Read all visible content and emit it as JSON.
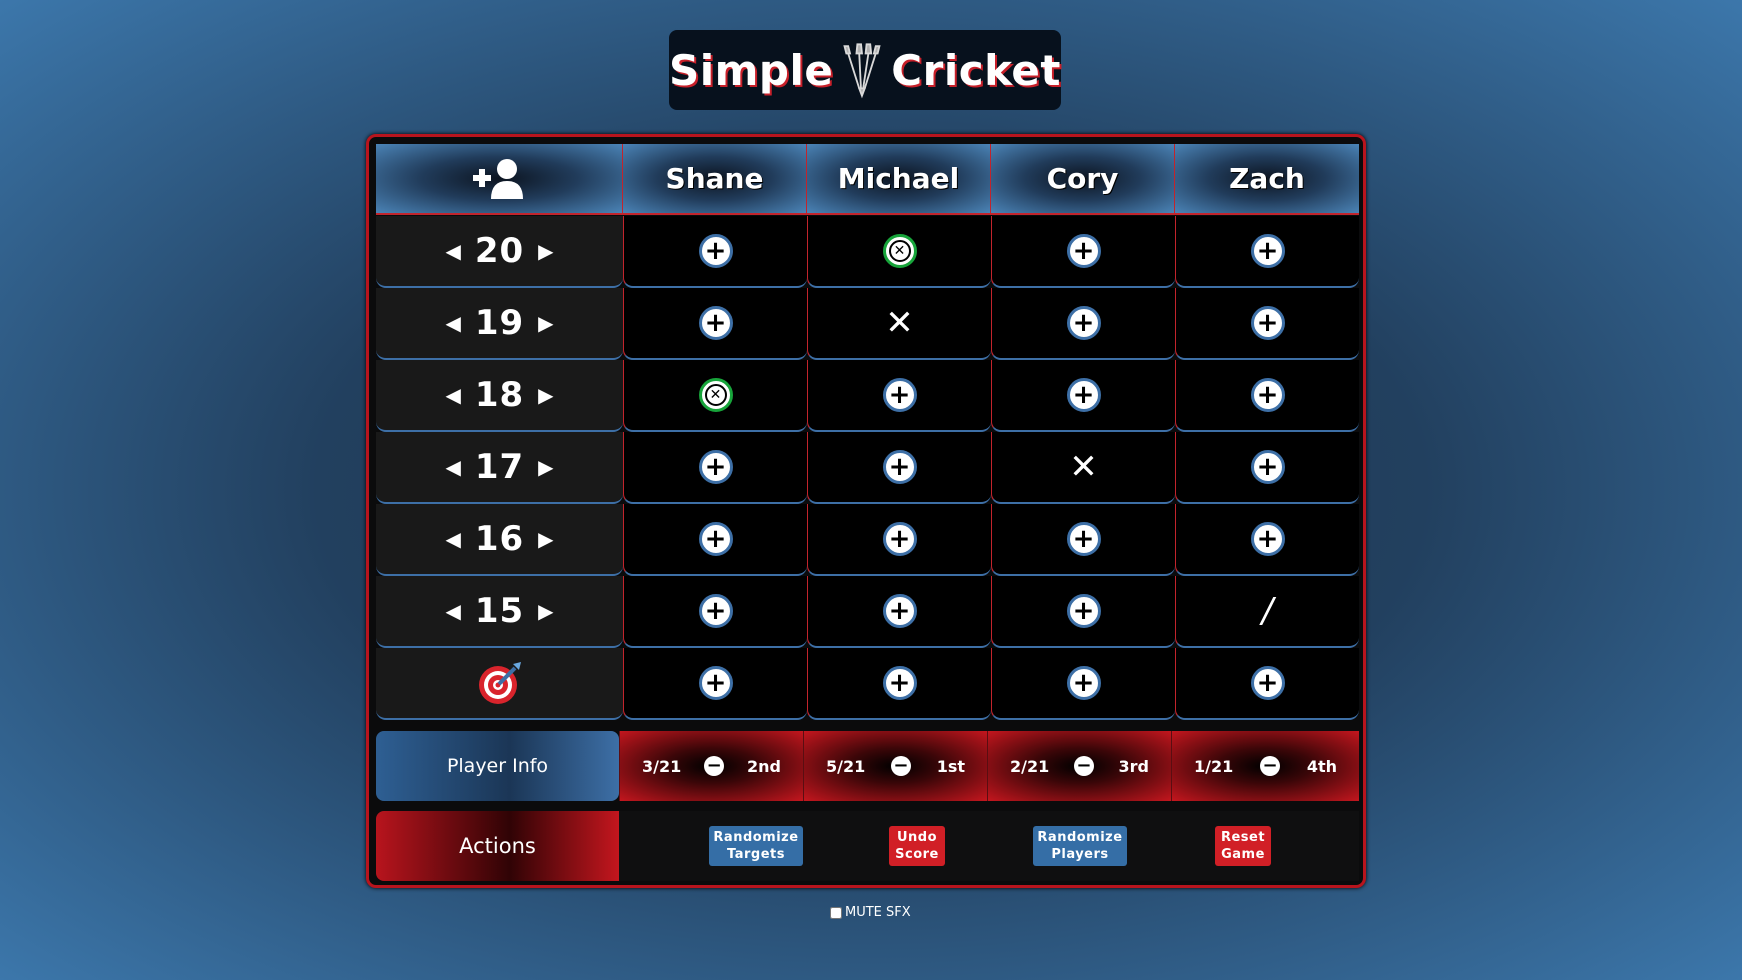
{
  "app": {
    "title_left": "Simple",
    "title_right": "Cricket",
    "logo_icon": "darts-icon"
  },
  "header": {
    "add_player_icon": "add-player-icon",
    "players": [
      "Shane",
      "Michael",
      "Cory",
      "Zach"
    ]
  },
  "targets": [
    {
      "label": "20",
      "prev_icon": "caret-left",
      "next_icon": "caret-right"
    },
    {
      "label": "19",
      "prev_icon": "caret-left",
      "next_icon": "caret-right"
    },
    {
      "label": "18",
      "prev_icon": "caret-left",
      "next_icon": "caret-right"
    },
    {
      "label": "17",
      "prev_icon": "caret-left",
      "next_icon": "caret-right"
    },
    {
      "label": "16",
      "prev_icon": "caret-left",
      "next_icon": "caret-right"
    },
    {
      "label": "15",
      "prev_icon": "caret-left",
      "next_icon": "caret-right"
    },
    {
      "label": "",
      "icon": "bullseye-icon"
    }
  ],
  "marks": [
    [
      "plus",
      "closed",
      "plus",
      "plus"
    ],
    [
      "plus",
      "x",
      "plus",
      "plus"
    ],
    [
      "closed",
      "plus",
      "plus",
      "plus"
    ],
    [
      "plus",
      "plus",
      "x",
      "plus"
    ],
    [
      "plus",
      "plus",
      "plus",
      "plus"
    ],
    [
      "plus",
      "plus",
      "plus",
      "slash"
    ],
    [
      "plus",
      "plus",
      "plus",
      "plus"
    ]
  ],
  "mark_symbols": {
    "plus": "+",
    "x": "✕",
    "slash": "/",
    "closed": "✕"
  },
  "player_info": {
    "label": "Player Info",
    "players": [
      {
        "score": "3/21",
        "place": "2nd"
      },
      {
        "score": "5/21",
        "place": "1st"
      },
      {
        "score": "2/21",
        "place": "3rd"
      },
      {
        "score": "1/21",
        "place": "4th"
      }
    ]
  },
  "actions": {
    "label": "Actions",
    "buttons": [
      {
        "line1": "Randomize",
        "line2": "Targets",
        "color": "#356ea6"
      },
      {
        "line1": "Undo",
        "line2": "Score",
        "color": "#d11f26"
      },
      {
        "line1": "Randomize",
        "line2": "Players",
        "color": "#356ea6"
      },
      {
        "line1": "Reset",
        "line2": "Game",
        "color": "#d11f26"
      }
    ]
  },
  "mute": {
    "label": "MUTE SFX",
    "checked": false
  },
  "colors": {
    "accent_red": "#c2242c",
    "accent_blue": "#3d6fa6",
    "closed_green": "#17a43a"
  }
}
